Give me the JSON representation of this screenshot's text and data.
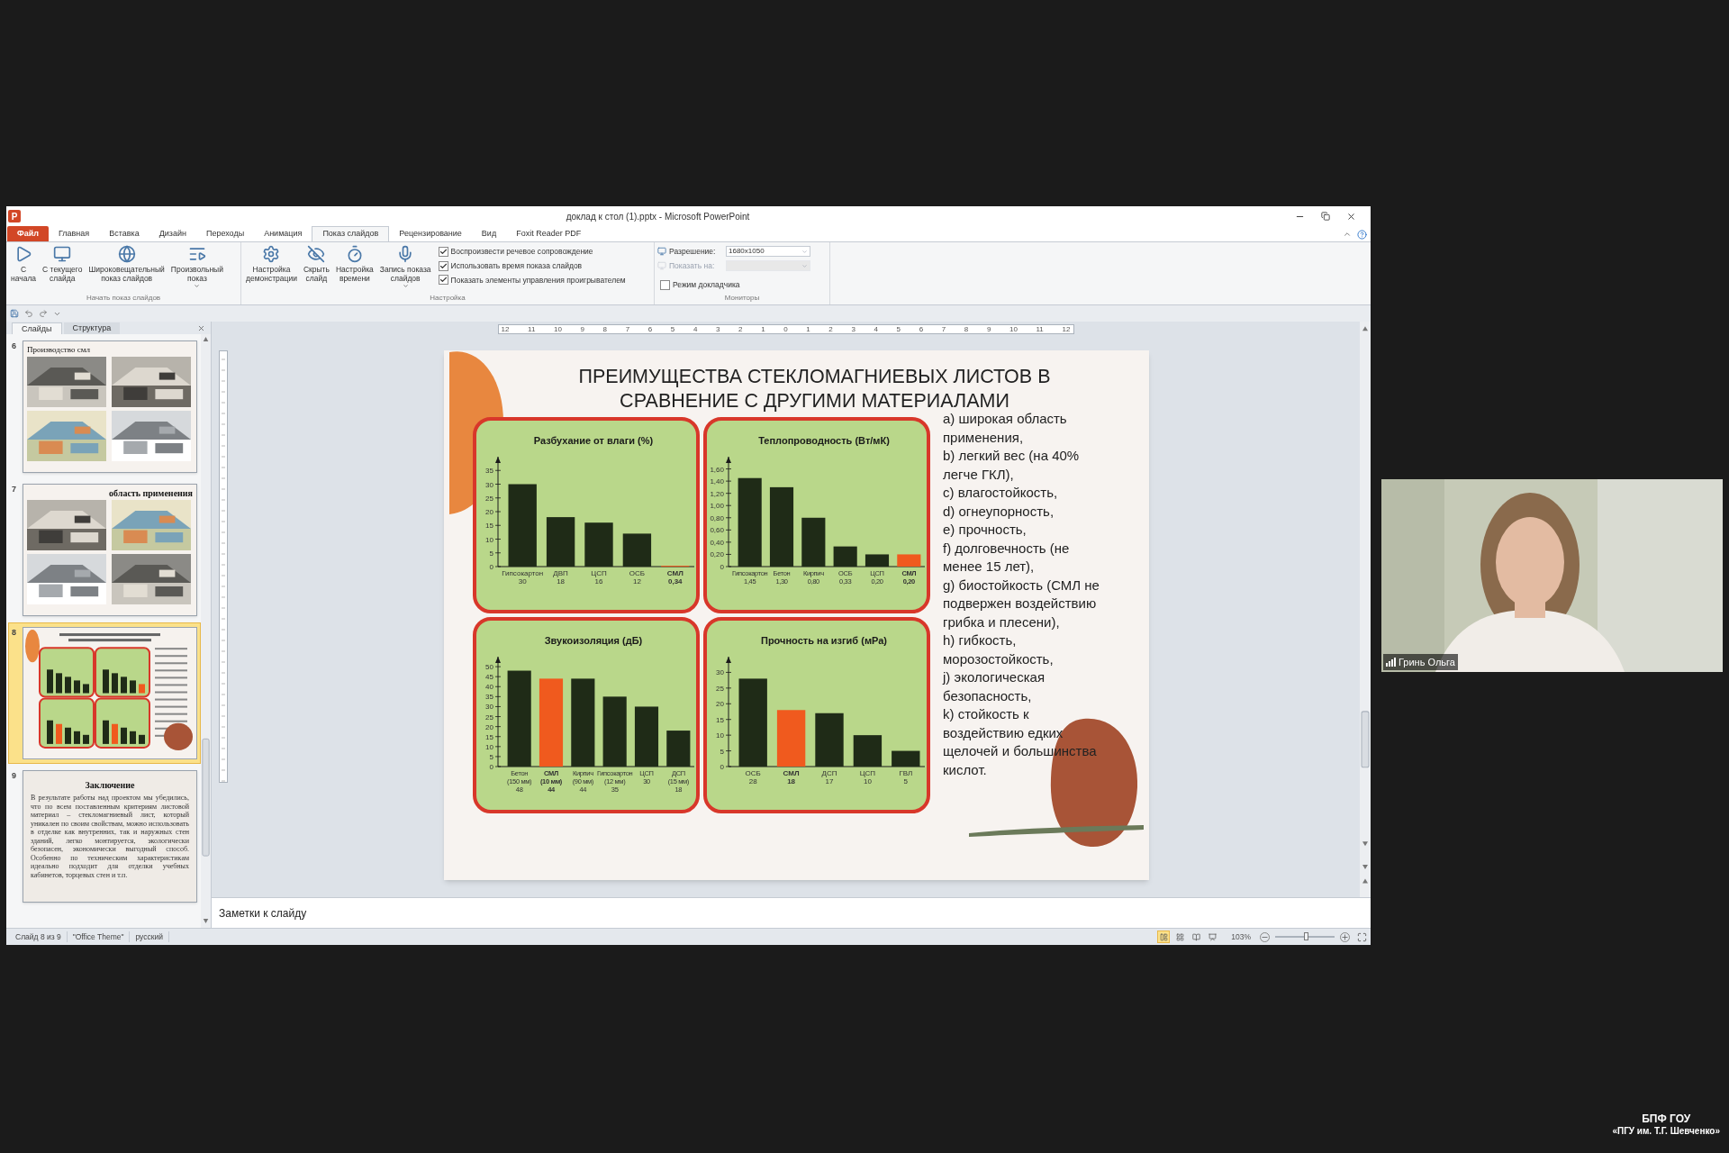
{
  "window": {
    "app_logo": "P",
    "title": "доклад к стол (1).pptx - Microsoft PowerPoint"
  },
  "ribbon_tabs": [
    {
      "label": "Файл",
      "kind": "file",
      "selected": false
    },
    {
      "label": "Главная",
      "kind": "tab",
      "selected": false
    },
    {
      "label": "Вставка",
      "kind": "tab",
      "selected": false
    },
    {
      "label": "Дизайн",
      "kind": "tab",
      "selected": false
    },
    {
      "label": "Переходы",
      "kind": "tab",
      "selected": false
    },
    {
      "label": "Анимация",
      "kind": "tab",
      "selected": false
    },
    {
      "label": "Показ слайдов",
      "kind": "tab",
      "selected": true
    },
    {
      "label": "Рецензирование",
      "kind": "tab",
      "selected": false
    },
    {
      "label": "Вид",
      "kind": "tab",
      "selected": false
    },
    {
      "label": "Foxit Reader PDF",
      "kind": "tab",
      "selected": false
    }
  ],
  "ribbon_groups": [
    {
      "label": "Начать показ слайдов",
      "buttons": [
        {
          "lines": [
            "С",
            "начала"
          ],
          "dropdown": false
        },
        {
          "lines": [
            "С текущего",
            "слайда"
          ],
          "dropdown": false
        },
        {
          "lines": [
            "Широковещательный",
            "показ слайдов"
          ],
          "dropdown": false
        },
        {
          "lines": [
            "Произвольный",
            "показ"
          ],
          "dropdown": true
        }
      ]
    },
    {
      "label": "Настройка",
      "buttons": [
        {
          "lines": [
            "Настройка",
            "демонстрации"
          ],
          "dropdown": false
        },
        {
          "lines": [
            "Скрыть",
            "слайд"
          ],
          "dropdown": false
        },
        {
          "lines": [
            "Настройка",
            "времени"
          ],
          "dropdown": false
        },
        {
          "lines": [
            "Запись показа",
            "слайдов"
          ],
          "dropdown": true
        }
      ],
      "checkboxes": [
        {
          "label": "Воспроизвести речевое сопровождение",
          "checked": true
        },
        {
          "label": "Использовать время показа слайдов",
          "checked": true
        },
        {
          "label": "Показать элементы управления проигрывателем",
          "checked": true
        }
      ]
    },
    {
      "label": "Мониторы",
      "fields": [
        {
          "label": "Разрешение:",
          "value": "1680x1050",
          "disabled": false
        },
        {
          "label": "Показать на:",
          "disabled": true
        }
      ],
      "checkboxes": [
        {
          "label": "Режим докладчика",
          "checked": false
        }
      ]
    }
  ],
  "panel_tabs": [
    {
      "label": "Слайды",
      "selected": true
    },
    {
      "label": "Структура",
      "selected": false
    }
  ],
  "slides": [
    {
      "number": "6",
      "kind": "photos",
      "title": "Производство смл",
      "selected": false
    },
    {
      "number": "7",
      "kind": "photos_titled",
      "title": "область применения",
      "selected": false
    },
    {
      "number": "8",
      "kind": "preview",
      "selected": true
    },
    {
      "number": "9",
      "kind": "text",
      "title": "Заключение",
      "body": "В результате работы над проектом мы убедились, что по всем поставленным критериям листовой материал – стекломагниевый лист, который уникален по своим свойствам, можно использовать в отделке как внутренних, так и наружных стен зданий, легко монтируется, экологически безопасен, экономически выгодный способ. Особенно по техническим характеристикам идеально подходит для отделки учебных кабинетов, торцевых стен и т.п.",
      "selected": false
    }
  ],
  "ruler_labels": [
    "12",
    "11",
    "10",
    "9",
    "8",
    "7",
    "6",
    "5",
    "4",
    "3",
    "2",
    "1",
    "0",
    "1",
    "2",
    "3",
    "4",
    "5",
    "6",
    "7",
    "8",
    "9",
    "10",
    "11",
    "12"
  ],
  "slide": {
    "title_lines": [
      "ПРЕИМУЩЕСТВА СТЕКЛОМАГНИЕВЫХ ЛИСТОВ В",
      "СРАВНЕНИЕ С ДРУГИМИ МАТЕРИАЛАМИ"
    ],
    "charts": [
      {
        "chart_data": {
          "type": "bar",
          "title": "Разбухание от влаги (%)",
          "categories": [
            "Гипсокартон\n30",
            "ДВП\n18",
            "ЦСП\n16",
            "ОСБ\n12",
            "СМЛ\n0,34"
          ],
          "series": [
            {
              "color": "#1f2b17",
              "values": [
                30,
                18,
                16,
                12,
                0.3
              ],
              "colors": [
                "#1f2b17",
                "#1f2b17",
                "#1f2b17",
                "#1f2b17",
                "#f05a1e"
              ]
            }
          ],
          "ylim": [
            0,
            40
          ],
          "yticks": [
            0,
            5,
            10,
            15,
            20,
            25,
            30,
            35
          ]
        }
      },
      {
        "chart_data": {
          "type": "bar",
          "title": "Теплопроводность (Вт/мК)",
          "categories": [
            "Гипсокартон\n1,45",
            "Бетон\n1,30",
            "Кирпич\n0,80",
            "ОСБ\n0,33",
            "ЦСП\n0,20",
            "СМЛ\n0,20"
          ],
          "series": [
            {
              "color": "#1f2b17",
              "values": [
                1.45,
                1.3,
                0.8,
                0.33,
                0.2,
                0.2
              ],
              "colors": [
                "#1f2b17",
                "#1f2b17",
                "#1f2b17",
                "#1f2b17",
                "#1f2b17",
                "#f05a1e"
              ]
            }
          ],
          "ylim": [
            0,
            1.8
          ],
          "yticks": [
            0,
            {
              "value": 0.2,
              "label": "0,20"
            },
            {
              "value": 0.4,
              "label": "0,40"
            },
            {
              "value": 0.6,
              "label": "0,60"
            },
            {
              "value": 0.8,
              "label": "0,80"
            },
            {
              "value": 1.0,
              "label": "1,00"
            },
            {
              "value": 1.2,
              "label": "1,20"
            },
            {
              "value": 1.4,
              "label": "1,40"
            },
            {
              "value": 1.6,
              "label": "1,60"
            }
          ]
        }
      },
      {
        "chart_data": {
          "type": "bar",
          "title": "Звукоизоляция (дБ)",
          "categories": [
            "Бетон\n(150 мм)\n48",
            "СМЛ\n(10 мм)\n44",
            "Кирпич\n(90 мм)\n44",
            "Гипсокартон\n(12 мм)\n35",
            "ЦСП\n30",
            "ДСП\n(15 мм)\n18"
          ],
          "series": [
            {
              "color": "#1f2b17",
              "values": [
                48,
                44,
                44,
                35,
                30,
                18
              ],
              "colors": [
                "#1f2b17",
                "#f05a1e",
                "#1f2b17",
                "#1f2b17",
                "#1f2b17",
                "#1f2b17"
              ]
            }
          ],
          "ylim": [
            0,
            55
          ],
          "yticks": [
            0,
            5,
            10,
            15,
            20,
            25,
            30,
            35,
            40,
            45,
            50
          ]
        }
      },
      {
        "chart_data": {
          "type": "bar",
          "title": "Прочность на изгиб (мРа)",
          "categories": [
            "ОСБ\n28",
            "СМЛ\n18",
            "ДСП\n17",
            "ЦСП\n10",
            "ГВЛ\n5"
          ],
          "series": [
            {
              "color": "#1f2b17",
              "values": [
                28,
                18,
                17,
                10,
                5
              ],
              "colors": [
                "#1f2b17",
                "#f05a1e",
                "#1f2b17",
                "#1f2b17",
                "#1f2b17"
              ]
            }
          ],
          "ylim": [
            0,
            35
          ],
          "yticks": [
            0,
            5,
            10,
            15,
            20,
            25,
            30
          ]
        }
      }
    ],
    "points": [
      "а) широкая область применения,",
      "b) легкий вес (на 40% легче ГКЛ),",
      "c) влагостойкость,",
      "d) огнеупорность,",
      "e) прочность,",
      "f) долговечность (не менее 15 лет),",
      "g) биостойкость (СМЛ не подвержен воздействию грибка и плесени),",
      "h) гибкость, морозостойкость,",
      "j) экологическая безопасность,",
      "k) стойкость к воздействию едких щелочей и большинства кислот."
    ]
  },
  "notes": {
    "placeholder": "Заметки к слайду"
  },
  "status_bar": {
    "items": [
      "Слайд 8 из 9",
      "\"Office Theme\"",
      "русский"
    ],
    "view_buttons": [
      {
        "kind": "normal",
        "selected": true
      },
      {
        "kind": "sorter",
        "selected": false
      },
      {
        "kind": "reading",
        "selected": false
      },
      {
        "kind": "slideshow",
        "selected": false
      }
    ],
    "zoom": "103%",
    "zoom_slider": {
      "level": 0.52
    }
  },
  "video": {
    "name": "Гринь Ольга"
  },
  "caption": [
    "БПФ ГОУ",
    "«ПГУ им. Т.Г. Шевченко»"
  ]
}
